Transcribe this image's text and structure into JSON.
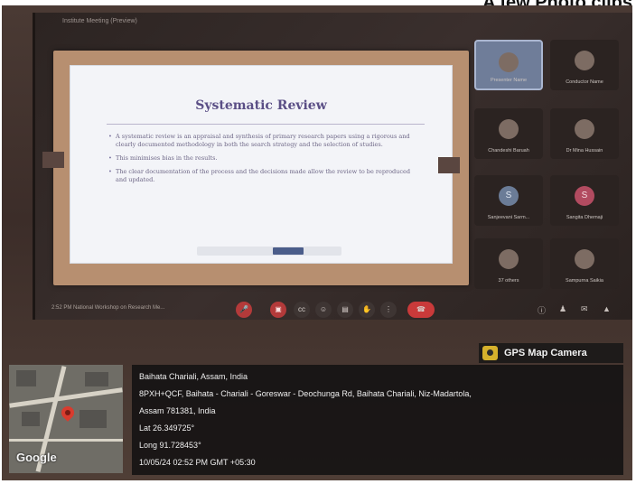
{
  "heading": "A few Photo clips",
  "meeting": {
    "window_title": "Institute Meeting (Preview)",
    "slide": {
      "title": "Systematic Review",
      "bullets": [
        "A systematic review is an appraisal and synthesis of primary research papers using a rigorous and clearly documented methodology in both the search strategy and the selection of studies.",
        "This minimises bias in the results.",
        "The clear documentation of the process and the decisions made allow the review to be reproduced and updated."
      ]
    },
    "participants": [
      {
        "name": "Presenter Name",
        "avatar": "",
        "active": true
      },
      {
        "name": "Conductor Name",
        "avatar": "",
        "active": false
      },
      {
        "name": "Chandeshi Baruah",
        "avatar": "",
        "active": false
      },
      {
        "name": "Dr Mina Hussain",
        "avatar": "",
        "active": false
      },
      {
        "name": "Sanjeevani Sarm...",
        "avatar": "S",
        "active": false
      },
      {
        "name": "Sangita Dhemaji",
        "avatar": "S",
        "active": false
      },
      {
        "name": "37 others",
        "avatar": "",
        "active": false
      },
      {
        "name": "Sampurna Saikia",
        "avatar": "",
        "active": false
      }
    ],
    "toolbar": {
      "time_and_title": "2:52 PM  National Workshop on Research Me...",
      "icons": [
        "mic-off-icon",
        "camera-off-icon",
        "captions-icon",
        "emoji-icon",
        "present-icon",
        "hand-icon",
        "more-icon",
        "end-call-icon"
      ],
      "right_icons": [
        "info-icon",
        "people-icon",
        "chat-icon",
        "activities-icon"
      ]
    }
  },
  "overlay": {
    "app_label": "GPS Map Camera",
    "location_title": "Baihata Chariali, Assam, India",
    "address_line1": "8PXH+QCF, Baihata - Chariali - Goreswar - Deochunga Rd, Baihata Chariali, Niz-Madartola,",
    "address_line2": "Assam 781381, India",
    "lat": "Lat 26.349725°",
    "long": "Long 91.728453°",
    "datetime": "10/05/24 02:52 PM GMT +05:30",
    "map_brand": "Google"
  }
}
